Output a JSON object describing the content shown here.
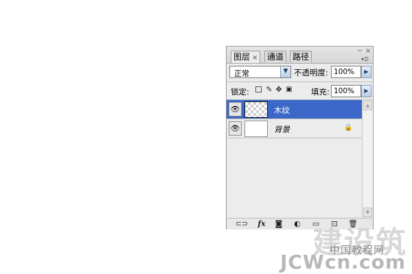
{
  "panel": {
    "tabs": [
      {
        "label": "图层",
        "close": "×"
      },
      {
        "label": "通道"
      },
      {
        "label": "路径"
      }
    ],
    "window_buttons": {
      "minimize": "−",
      "close": "×",
      "menu": "▾☰"
    },
    "blend_mode": {
      "value": "正常"
    },
    "opacity": {
      "label": "不透明度:",
      "value": "100%"
    },
    "lock": {
      "label": "锁定:"
    },
    "fill": {
      "label": "填充:",
      "value": "100%"
    },
    "layers": [
      {
        "name": "木纹",
        "selected": true,
        "thumbnail": "transparent"
      },
      {
        "name": "背景",
        "selected": false,
        "thumbnail": "white",
        "locked": true
      }
    ],
    "toolbar_icons": [
      "link-icon",
      "fx-icon",
      "mask-icon",
      "adjustment-icon",
      "group-icon",
      "new-layer-icon",
      "trash-icon"
    ],
    "toolbar_labels": {
      "fx": "fx"
    }
  },
  "watermark": {
    "line1": "建设筑",
    "line2": "中国教程网",
    "line3": "JCWcn.com"
  }
}
